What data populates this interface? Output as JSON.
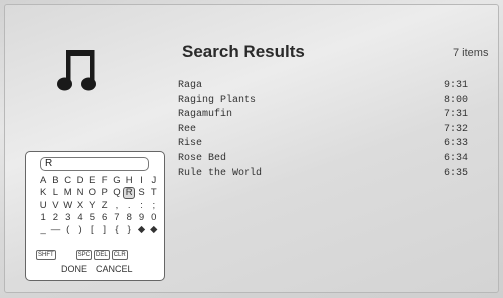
{
  "header": {
    "title": "Search Results",
    "count": "7 items"
  },
  "results": [
    {
      "title": "Raga",
      "duration": "9:31"
    },
    {
      "title": "Raging Plants",
      "duration": "8:00"
    },
    {
      "title": "Ragamufin",
      "duration": "7:31"
    },
    {
      "title": "Ree",
      "duration": "7:32"
    },
    {
      "title": "Rise",
      "duration": "6:33"
    },
    {
      "title": "Rose Bed",
      "duration": "6:34"
    },
    {
      "title": "Rule the World",
      "duration": "6:35"
    }
  ],
  "keyboard": {
    "input_value": "R",
    "rows": [
      [
        "A",
        "B",
        "C",
        "D",
        "E",
        "F",
        "G",
        "H",
        "I",
        "J"
      ],
      [
        "K",
        "L",
        "M",
        "N",
        "O",
        "P",
        "Q",
        "R",
        "S",
        "T"
      ],
      [
        "U",
        "V",
        "W",
        "X",
        "Y",
        "Z",
        ",",
        ".",
        ":",
        ";"
      ],
      [
        "1",
        "2",
        "3",
        "4",
        "5",
        "6",
        "7",
        "8",
        "9",
        "0"
      ],
      [
        "_",
        "—",
        "(",
        ")",
        "[",
        "]",
        "{",
        "}",
        "◆",
        "◆"
      ]
    ],
    "selected_key": "R",
    "function_keys": {
      "shift": "SHFT",
      "space": "SPC",
      "delete": "DEL",
      "clear": "CLR"
    },
    "actions": {
      "done": "DONE",
      "cancel": "CANCEL"
    }
  },
  "icons": {
    "main": "music-note-icon"
  },
  "colors": {
    "background": "#dcdcdc",
    "text": "#333333"
  }
}
